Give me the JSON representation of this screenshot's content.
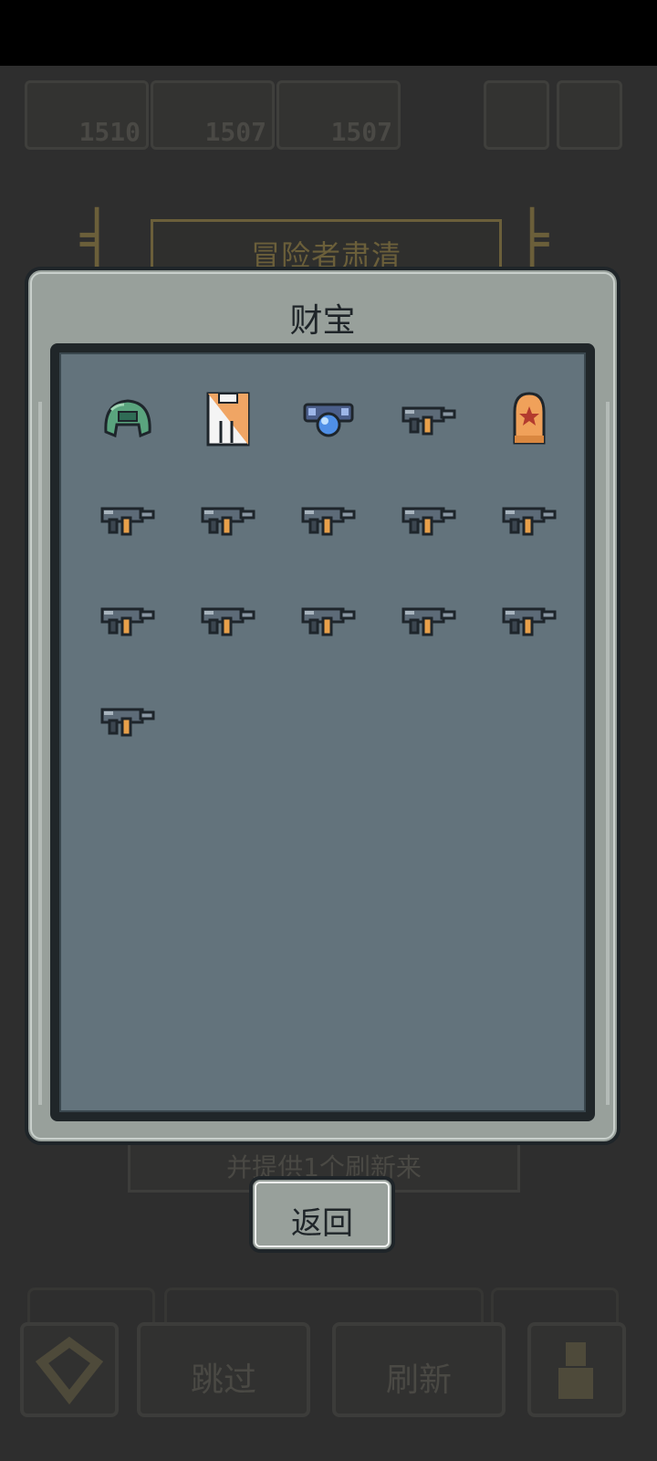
{
  "background": {
    "resources": [
      {
        "value": "1510"
      },
      {
        "value": "1507"
      },
      {
        "value": "1507"
      }
    ],
    "banner_title": "冒险者肃清",
    "hidden_line": "并提供1个刷新来",
    "bottom_bar": {
      "skip_label": "跳过",
      "refresh_label": "刷新"
    }
  },
  "modal": {
    "title": "财宝",
    "back_label": "返回",
    "items": [
      {
        "icon": "green-helmet-icon"
      },
      {
        "icon": "orange-white-vest-icon"
      },
      {
        "icon": "blue-orb-amulet-icon"
      },
      {
        "icon": "smg-gun-icon"
      },
      {
        "icon": "bullet-star-icon"
      },
      {
        "icon": "smg-gun-icon"
      },
      {
        "icon": "smg-gun-icon"
      },
      {
        "icon": "smg-gun-icon"
      },
      {
        "icon": "smg-gun-icon"
      },
      {
        "icon": "smg-gun-icon"
      },
      {
        "icon": "smg-gun-icon"
      },
      {
        "icon": "smg-gun-icon"
      },
      {
        "icon": "smg-gun-icon"
      },
      {
        "icon": "smg-gun-icon"
      },
      {
        "icon": "smg-gun-icon"
      },
      {
        "icon": "smg-gun-icon"
      }
    ]
  },
  "colors": {
    "modal_frame": "#98a09b",
    "modal_inner": "#63737c",
    "outline_dark": "#1f2529",
    "gun_accent": "#e8a04a"
  }
}
